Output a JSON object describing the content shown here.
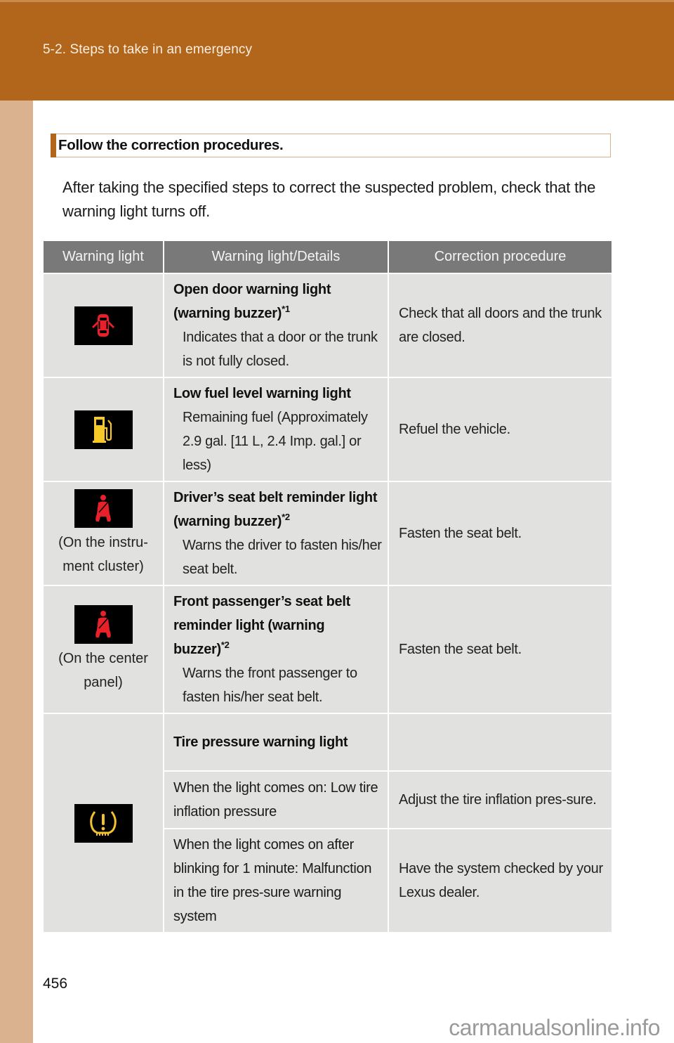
{
  "header": {
    "section_title": "5-2. Steps to take in an emergency"
  },
  "section_heading": "Follow the correction procedures.",
  "intro_text": "After taking the specified steps to correct the suspected problem, check that the warning light turns off.",
  "table": {
    "columns": [
      "Warning light",
      "Warning light/Details",
      "Correction procedure"
    ],
    "rows": [
      {
        "icon": "open-door-icon",
        "icon_color": "#e8202a",
        "caption": "",
        "title": "Open door warning light (warning buzzer)",
        "note": "*1",
        "details": "Indicates that a door or the trunk is not fully closed.",
        "procedure": "Check that all doors and the trunk are closed."
      },
      {
        "icon": "fuel-pump-icon",
        "icon_color": "#f7c928",
        "caption": "",
        "title": "Low fuel level warning light",
        "note": "",
        "details": "Remaining fuel (Approximately 2.9 gal. [11 L, 2.4 Imp. gal.] or less)",
        "procedure": "Refuel the vehicle."
      },
      {
        "icon": "seat-belt-icon",
        "icon_color": "#e8202a",
        "caption": "(On the instru-ment cluster)",
        "title": "Driver’s seat belt reminder light (warning buzzer)",
        "note": "*2",
        "details": "Warns the driver to fasten his/her seat belt.",
        "procedure": "Fasten the seat belt."
      },
      {
        "icon": "seat-belt-icon",
        "icon_color": "#e8202a",
        "caption": "(On the center panel)",
        "title": "Front passenger’s seat belt reminder light (warning buzzer)",
        "note": "*2",
        "details": "Warns the front passenger to fasten his/her seat belt.",
        "procedure": "Fasten the seat belt."
      },
      {
        "icon": "tire-pressure-icon",
        "icon_color": "#f2c230",
        "title": "Tire pressure warning light",
        "subrows": [
          {
            "condition": "When the light comes on: Low tire inflation pressure",
            "procedure": "Adjust the tire inflation pres-sure."
          },
          {
            "condition": "When the light comes on after blinking for 1 minute: Malfunction in the tire pres-sure warning system",
            "procedure": "Have the system checked by your Lexus dealer."
          }
        ]
      }
    ]
  },
  "footer": {
    "page_number": "456",
    "watermark": "carmanualsonline.info"
  },
  "colors": {
    "header_band": "#b1661c",
    "side_strip": "#dbb28f",
    "table_header": "#797979",
    "table_cell": "#e1e1e0"
  }
}
